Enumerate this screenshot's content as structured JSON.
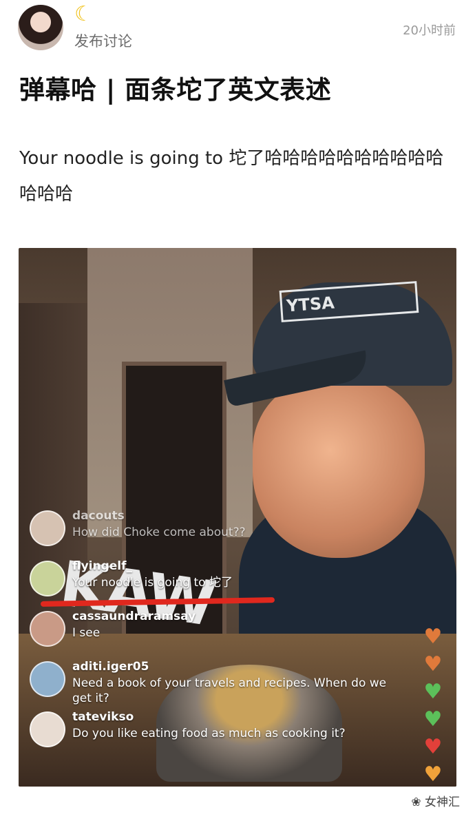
{
  "post": {
    "author": "发布讨论",
    "time": "20小时前",
    "title": "弹幕哈 | 面条坨了英文表述",
    "body": "Your noodle is going to 坨了哈哈哈哈哈哈哈哈哈哈哈哈哈"
  },
  "video": {
    "cap_logo": "YTSA",
    "shirt_print": "KAW",
    "comments": [
      {
        "user": "dacouts",
        "text": "How did Choke come about??"
      },
      {
        "user": "flyingelf_",
        "text": "Your noodle is going to 坨了"
      },
      {
        "user": "cassaundraramsay",
        "text": "I see"
      },
      {
        "user": "aditi.iger05",
        "text": "Need a book of your travels and recipes. When do we get it?"
      },
      {
        "user": "tateviksо",
        "text": "Do you like eating food as much as cooking it?"
      }
    ],
    "hearts": [
      {
        "color": "#e07a3b",
        "icon": "heart-icon"
      },
      {
        "color": "#e07a3b",
        "icon": "heart-icon"
      },
      {
        "color": "#5cc05a",
        "icon": "heart-icon"
      },
      {
        "color": "#5cc05a",
        "icon": "heart-icon"
      },
      {
        "color": "#e2403a",
        "icon": "heart-icon"
      },
      {
        "color": "#f0a23a",
        "icon": "heart-icon"
      }
    ]
  },
  "footer": {
    "brand": "女神汇"
  }
}
